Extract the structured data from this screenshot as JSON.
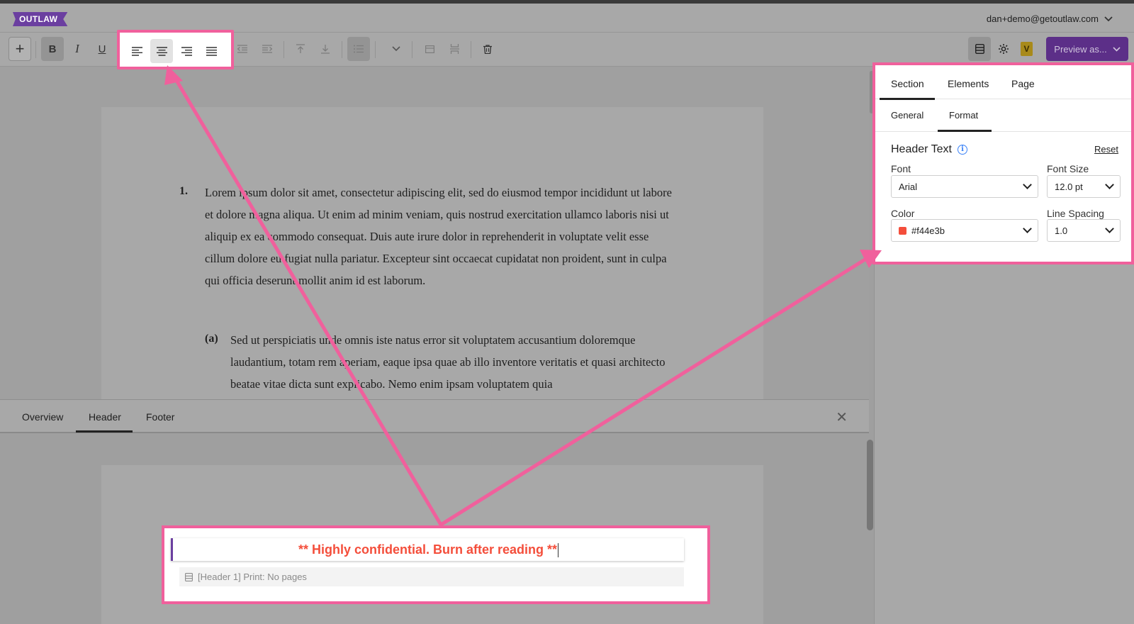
{
  "app": {
    "logo": "OUTLAW",
    "user_email": "dan+demo@getoutlaw.com"
  },
  "toolbar": {
    "add_icon": "+",
    "bold_label": "B",
    "italic_label": "I",
    "underline_label": "U",
    "preview_label": "Preview as...",
    "v_badge": "V"
  },
  "document": {
    "item_number": "1.",
    "item_text": "Lorem ipsum dolor sit amet, consectetur adipiscing elit, sed do eiusmod tempor incididunt ut labore et dolore magna aliqua. Ut enim ad minim veniam, quis nostrud exercitation ullamco laboris nisi ut aliquip ex ea commodo consequat. Duis aute irure dolor in reprehenderit in voluptate velit esse cillum dolore eu fugiat nulla pariatur. Excepteur sint occaecat cupidatat non proident, sunt in culpa qui officia deserunt mollit anim id est laborum.",
    "sub_number": "(a)",
    "sub_text": "Sed ut perspiciatis unde omnis iste natus error sit voluptatem accusantium doloremque laudantium, totam rem aperiam, eaque ipsa quae ab illo inventore veritatis et quasi architecto beatae vitae dicta sunt explicabo. Nemo enim ipsam voluptatem quia"
  },
  "bottom_panel": {
    "tabs": [
      "Overview",
      "Header",
      "Footer"
    ],
    "active_tab": "Header",
    "close_icon": "✕",
    "header_text": "** Highly confidential. Burn after reading **",
    "header_info": "[Header 1]  Print: No pages"
  },
  "right_panel": {
    "tabs": [
      "Section",
      "Elements",
      "Page"
    ],
    "active_tab": "Section",
    "subtabs": [
      "General",
      "Format"
    ],
    "active_subtab": "Format",
    "section_title": "Header Text",
    "reset_label": "Reset",
    "font_label": "Font",
    "font_value": "Arial",
    "font_size_label": "Font Size",
    "font_size_value": "12.0 pt",
    "color_label": "Color",
    "color_value": "#f44e3b",
    "line_spacing_label": "Line Spacing",
    "line_spacing_value": "1.0"
  },
  "colors": {
    "accent": "#6b3fa0",
    "highlight": "#f0609c",
    "header_text": "#f44e3b"
  }
}
